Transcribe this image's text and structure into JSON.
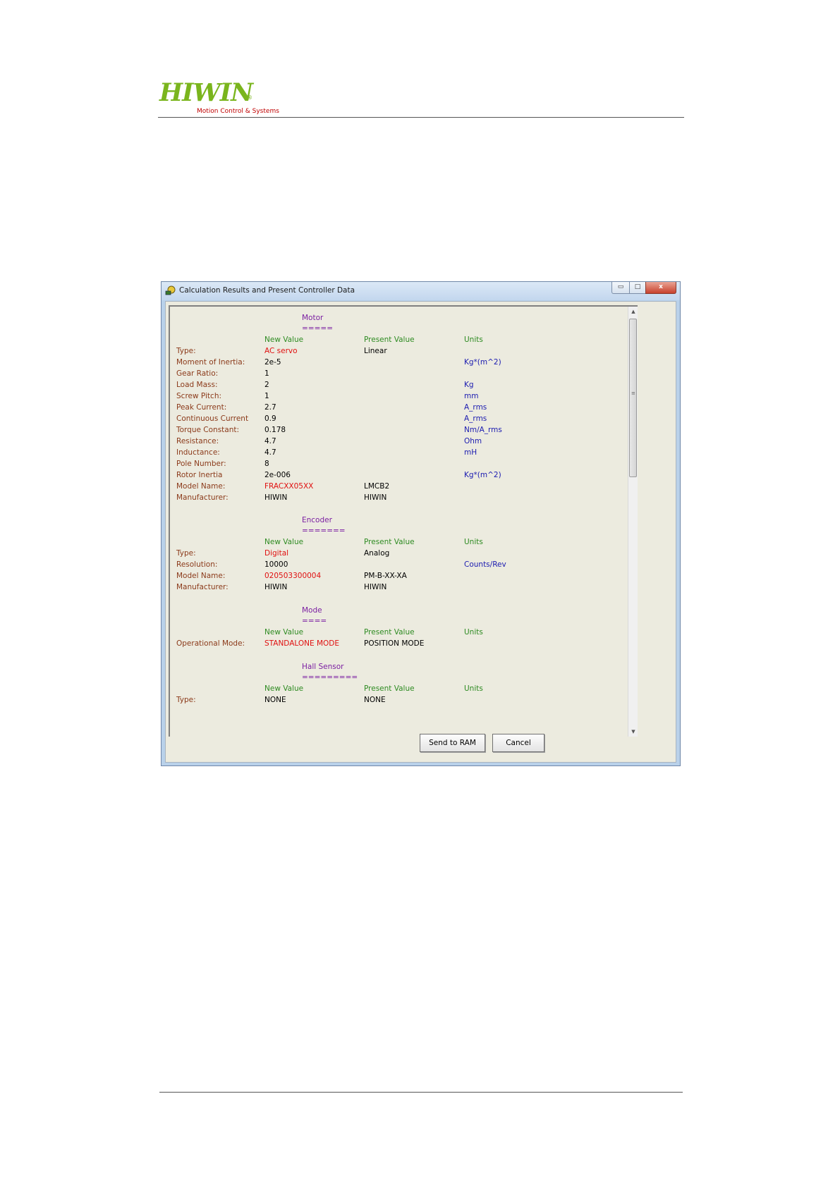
{
  "header": {
    "logo_text": "HIWIN",
    "logo_reg": "®",
    "logo_subtitle": "Motion Control & Systems"
  },
  "window": {
    "title": "Calculation Results and Present Controller Data",
    "min_glyph": "▭",
    "max_glyph": "□",
    "close_glyph": "x"
  },
  "scrollbar": {
    "up_glyph": "▲",
    "down_glyph": "▼",
    "grip_glyph": "≡"
  },
  "sections": {
    "motor": {
      "title": "Motor",
      "underline": "=====",
      "col_new": "New Value",
      "col_present": "Present Value",
      "col_units": "Units",
      "rows": [
        {
          "label": "Type:",
          "new": "AC servo",
          "present": "Linear",
          "unit": ""
        },
        {
          "label": "Moment of Inertia:",
          "new": "2e-5",
          "present": "",
          "unit": "Kg*(m^2)"
        },
        {
          "label": "Gear Ratio:",
          "new": "1",
          "present": "",
          "unit": ""
        },
        {
          "label": "Load Mass:",
          "new": "2",
          "present": "",
          "unit": "Kg"
        },
        {
          "label": "Screw Pitch:",
          "new": "1",
          "present": "",
          "unit": "mm"
        },
        {
          "label": "Peak Current:",
          "new": "2.7",
          "present": "",
          "unit": "A_rms"
        },
        {
          "label": "Continuous Current",
          "new": "0.9",
          "present": "",
          "unit": "A_rms"
        },
        {
          "label": "Torque Constant:",
          "new": "0.178",
          "present": "",
          "unit": "Nm/A_rms"
        },
        {
          "label": "Resistance:",
          "new": "4.7",
          "present": "",
          "unit": "Ohm"
        },
        {
          "label": "Inductance:",
          "new": "4.7",
          "present": "",
          "unit": "mH"
        },
        {
          "label": "Pole Number:",
          "new": "8",
          "present": "",
          "unit": ""
        },
        {
          "label": "Rotor Inertia",
          "new": "2e-006",
          "present": "",
          "unit": "Kg*(m^2)"
        },
        {
          "label": "Model Name:",
          "new": "FRACXX05XX",
          "present": "LMCB2",
          "unit": ""
        },
        {
          "label": "Manufacturer:",
          "new": "HIWIN",
          "present": "HIWIN",
          "unit": ""
        }
      ]
    },
    "encoder": {
      "title": "Encoder",
      "underline": "=======",
      "col_new": "New Value",
      "col_present": "Present Value",
      "col_units": "Units",
      "rows": [
        {
          "label": "Type:",
          "new": "Digital",
          "present": "Analog",
          "unit": ""
        },
        {
          "label": "Resolution:",
          "new": "10000",
          "present": "",
          "unit": "Counts/Rev"
        },
        {
          "label": "Model Name:",
          "new": "020503300004",
          "present": "PM-B-XX-XA",
          "unit": ""
        },
        {
          "label": "Manufacturer:",
          "new": "HIWIN",
          "present": "HIWIN",
          "unit": ""
        }
      ]
    },
    "mode": {
      "title": "Mode",
      "underline": "====",
      "col_new": "New Value",
      "col_present": "Present Value",
      "col_units": "Units",
      "rows": [
        {
          "label": "Operational Mode:",
          "new": "STANDALONE MODE",
          "present": "POSITION MODE",
          "unit": ""
        }
      ]
    },
    "hall": {
      "title": "Hall Sensor",
      "underline": "=========",
      "col_new": "New Value",
      "col_present": "Present Value",
      "col_units": "Units",
      "rows": [
        {
          "label": "Type:",
          "new": "NONE",
          "present": "NONE",
          "unit": ""
        }
      ]
    }
  },
  "buttons": {
    "send_label": "Send to RAM",
    "cancel_label": "Cancel"
  },
  "colors": {
    "logo_green": "#7ab51d",
    "label": "#8b3a1a",
    "header": "#7b1fa2",
    "column": "#2e8b22",
    "new_value": "#e01010",
    "unit": "#1b1bb0",
    "dialog_bg": "#ecebdf"
  }
}
